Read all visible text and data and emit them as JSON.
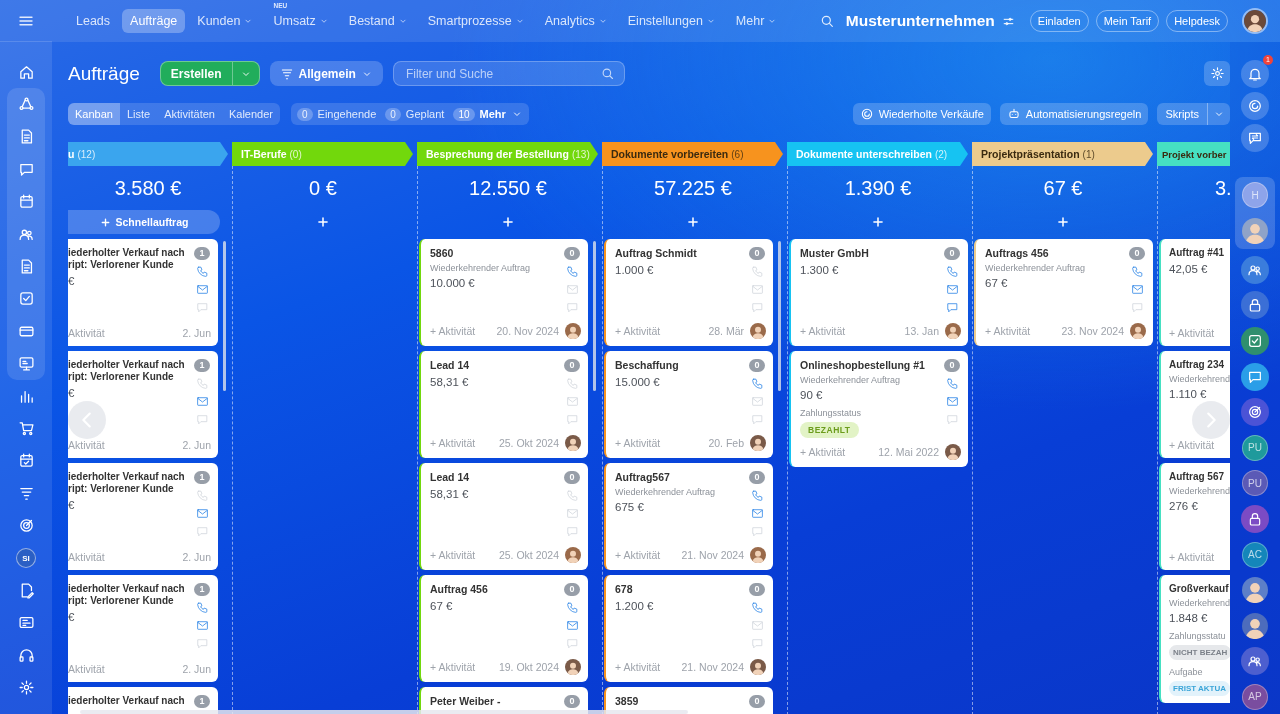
{
  "top_nav": {
    "items": [
      {
        "label": "Leads",
        "selected": false,
        "has_menu": false
      },
      {
        "label": "Aufträge",
        "selected": true,
        "has_menu": false
      },
      {
        "label": "Kunden",
        "selected": false,
        "has_menu": true
      },
      {
        "label": "Umsatz",
        "selected": false,
        "has_menu": true,
        "badge": "NEU"
      },
      {
        "label": "Bestand",
        "selected": false,
        "has_menu": true
      },
      {
        "label": "Smartprozesse",
        "selected": false,
        "has_menu": true
      },
      {
        "label": "Analytics",
        "selected": false,
        "has_menu": true
      },
      {
        "label": "Einstellungen",
        "selected": false,
        "has_menu": true
      },
      {
        "label": "Mehr",
        "selected": false,
        "has_menu": true
      }
    ],
    "company": "Musterunternehmen",
    "buttons": [
      "Einladen",
      "Mein Tarif",
      "Helpdesk"
    ]
  },
  "left_sidebar": {
    "avatar": "SI"
  },
  "page": {
    "title": "Aufträge",
    "create": "Erstellen",
    "filter": "Allgemein",
    "search_placeholder": "Filter und Suche"
  },
  "view_tabs": [
    {
      "label": "Kanban",
      "selected": true
    },
    {
      "label": "Liste",
      "selected": false
    },
    {
      "label": "Aktivitäten",
      "selected": false
    },
    {
      "label": "Kalender",
      "selected": false
    }
  ],
  "counters": [
    {
      "count": "0",
      "label": "Eingehende",
      "has_menu": false
    },
    {
      "count": "0",
      "label": "Geplant",
      "has_menu": false
    },
    {
      "count": "10",
      "label": "Mehr",
      "has_menu": true
    }
  ],
  "actions": [
    {
      "label": "Wiederholte Verkäufe",
      "kind": "recurring"
    },
    {
      "label": "Automatisierungsregeln",
      "kind": "automation"
    },
    {
      "label": "Skripts",
      "kind": "split"
    }
  ],
  "board": {
    "columns": [
      {
        "kind": "cut_left",
        "name": "u",
        "count": "(12)",
        "color": "#3aa5ee",
        "label_dark": false,
        "sum": "3.580 €",
        "quick_add": "Schnellauftrag",
        "cards": [
          {
            "title": "iederholter Verkauf nach\nript: Verlorener Kunde",
            "amount": "€",
            "count": "1",
            "contacts": {
              "phone": true,
              "mail": true,
              "chat": false
            },
            "activity": "Aktivität",
            "date": "2. Jun",
            "avatar": false
          },
          {
            "title": "iederholter Verkauf nach\nript: Verlorener Kunde",
            "amount": "€",
            "count": "1",
            "contacts": {
              "phone": false,
              "mail": true,
              "chat": false
            },
            "activity": "Aktivität",
            "date": "2. Jun",
            "avatar": false
          },
          {
            "title": "iederholter Verkauf nach\nript: Verlorener Kunde",
            "amount": "€",
            "count": "1",
            "contacts": {
              "phone": false,
              "mail": true,
              "chat": false
            },
            "activity": "Aktivität",
            "date": "2. Jun",
            "avatar": false
          },
          {
            "title": "iederholter Verkauf nach\nript: Verlorener Kunde",
            "amount": "€",
            "count": "1",
            "contacts": {
              "phone": true,
              "mail": true,
              "chat": false
            },
            "activity": "Aktivität",
            "date": "2. Jun",
            "avatar": false
          },
          {
            "title": "iederholter Verkauf nach",
            "count": "1"
          }
        ]
      },
      {
        "kind": "full",
        "name": "IT-Berufe",
        "count": "(0)",
        "color": "#72d80c",
        "label_dark": false,
        "sum": "0 €",
        "add_button": true
      },
      {
        "kind": "full",
        "name": "Besprechung der Bestellung",
        "count": "(13)",
        "color": "#72d80c",
        "label_dark": false,
        "sum": "12.550 €",
        "add_button": true,
        "cards": [
          {
            "title": "5860",
            "subtitle": "Wiederkehrender Auftrag",
            "amount": "10.000 €",
            "count": "0",
            "contacts": {
              "phone": true,
              "mail": false,
              "chat": false
            },
            "activity": "+ Aktivität",
            "date": "20. Nov 2024",
            "avatar": true
          },
          {
            "title": "Lead 14",
            "amount": "58,31 €",
            "count": "0",
            "contacts": {
              "phone": false,
              "mail": false,
              "chat": false
            },
            "activity": "+ Aktivität",
            "date": "25. Okt 2024",
            "avatar": true
          },
          {
            "title": "Lead 14",
            "amount": "58,31 €",
            "count": "0",
            "contacts": {
              "phone": false,
              "mail": false,
              "chat": false
            },
            "activity": "+ Aktivität",
            "date": "25. Okt 2024",
            "avatar": true
          },
          {
            "title": "Auftrag 456",
            "amount": "67 €",
            "count": "0",
            "contacts": {
              "phone": true,
              "mail": true,
              "chat": false
            },
            "activity": "+ Aktivität",
            "date": "19. Okt 2024",
            "avatar": true
          },
          {
            "title": "Peter Weiber -",
            "count": "0"
          }
        ]
      },
      {
        "kind": "full",
        "name": "Dokumente vorbereiten",
        "count": "(6)",
        "color": "#f7931e",
        "label_dark": true,
        "sum": "57.225 €",
        "add_button": true,
        "cards": [
          {
            "title": "Auftrag Schmidt",
            "amount": "1.000 €",
            "count": "0",
            "contacts": {
              "phone": false,
              "mail": false,
              "chat": false
            },
            "activity": "+ Aktivität",
            "date": "28. Mär",
            "avatar": true
          },
          {
            "title": "Beschaffung",
            "amount": "15.000 €",
            "count": "0",
            "contacts": {
              "phone": true,
              "mail": false,
              "chat": false
            },
            "activity": "+ Aktivität",
            "date": "20. Feb",
            "avatar": true
          },
          {
            "title": "Auftrag567",
            "subtitle": "Wiederkehrender Auftrag",
            "amount": "675 €",
            "count": "0",
            "contacts": {
              "phone": true,
              "mail": true,
              "chat": false
            },
            "activity": "+ Aktivität",
            "date": "21. Nov 2024",
            "avatar": true
          },
          {
            "title": "678",
            "amount": "1.200 €",
            "count": "0",
            "contacts": {
              "phone": true,
              "mail": false,
              "chat": false
            },
            "activity": "+ Aktivität",
            "date": "21. Nov 2024",
            "avatar": true
          },
          {
            "title": "3859",
            "count": "0"
          }
        ]
      },
      {
        "kind": "full",
        "name": "Dokumente unterschreiben",
        "count": "(2)",
        "color": "#16c3f2",
        "label_dark": false,
        "sum": "1.390 €",
        "add_button": true,
        "cards": [
          {
            "title": "Muster GmbH",
            "amount": "1.300 €",
            "count": "0",
            "contacts": {
              "phone": true,
              "mail": true,
              "chat": true
            },
            "activity": "+ Aktivität",
            "date": "13. Jan",
            "avatar": true
          },
          {
            "title": "Onlineshopbestellung #1",
            "subtitle": "Wiederkehrender Auftrag",
            "amount": "90 €",
            "fields": [
              {
                "label": "Zahlungsstatus",
                "badge": "BEZAHLT",
                "kind": "paid"
              }
            ],
            "count": "0",
            "contacts": {
              "phone": true,
              "mail": true,
              "chat": false
            },
            "activity": "+ Aktivität",
            "date": "12. Mai 2022",
            "avatar": true
          }
        ]
      },
      {
        "kind": "full",
        "name": "Projektpräsentation",
        "count": "(1)",
        "color": "#eccb8d",
        "label_dark": true,
        "sum": "67 €",
        "add_button": true,
        "cards": [
          {
            "title": "Auftrags 456",
            "subtitle": "Wiederkehrender Auftrag",
            "amount": "67 €",
            "count": "0",
            "contacts": {
              "phone": true,
              "mail": true,
              "chat": false
            },
            "activity": "+ Aktivität",
            "date": "23. Nov 2024",
            "avatar": true
          }
        ]
      },
      {
        "kind": "cut_right",
        "name": "Projekt vorber",
        "color": "#46e0c2",
        "label_dark": true,
        "sum": "3.",
        "cards": [
          {
            "title": "Auftrag #41",
            "amount": "42,05 €",
            "activity": "+ Aktivität"
          },
          {
            "title": "Auftrag 234",
            "subtitle": "Wiederkehrend",
            "amount": "1.110 €",
            "activity": "+ Aktivität"
          },
          {
            "title": "Auftrag 567",
            "subtitle": "Wiederkehrend",
            "amount": "276 €",
            "activity": "+ Aktivität"
          },
          {
            "title": "Großverkauf",
            "subtitle": "Wiederkehrend",
            "amount": "1.848 €",
            "fields": [
              {
                "label": "Zahlungsstatu",
                "badge": "NICHT BEZAH",
                "kind": "unpaid"
              },
              {
                "label": "Aufgabe",
                "badge": "FRIST AKTUA",
                "kind": "task"
              }
            ]
          }
        ]
      }
    ]
  },
  "right_sidebar": {
    "notification_count": "1",
    "avatars": [
      {
        "initials": "H",
        "color": "#8ea4ea"
      },
      {
        "initials": "PU",
        "color": "#1f9a9c"
      },
      {
        "initials": "PU",
        "color": "#5b5ab6"
      },
      {
        "initials": "AC",
        "color": "#1486ba"
      },
      {
        "initials": "AP",
        "color": "#7a4d9f"
      }
    ]
  }
}
